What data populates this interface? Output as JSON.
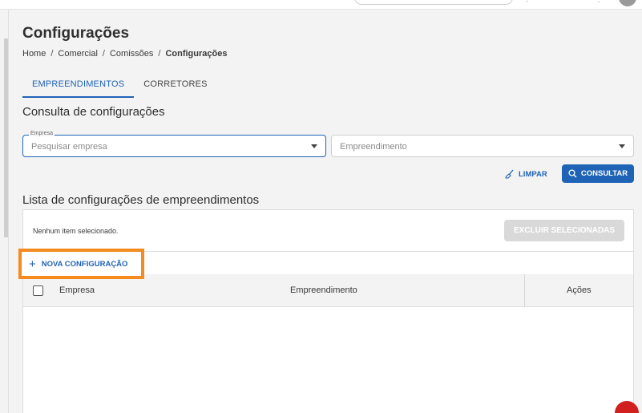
{
  "header": {
    "title": "Configurações"
  },
  "breadcrumb": {
    "items": [
      "Home",
      "Comercial",
      "Comissões",
      "Configurações"
    ],
    "separator": "/"
  },
  "tabs": [
    {
      "label": "EMPREENDIMENTOS",
      "active": true
    },
    {
      "label": "CORRETORES",
      "active": false
    }
  ],
  "query": {
    "title": "Consulta de configurações",
    "company": {
      "label": "Empresa",
      "placeholder": "Pesquisar empresa"
    },
    "development": {
      "placeholder": "Empreendimento"
    },
    "clear_label": "LIMPAR",
    "consult_label": "CONSULTAR"
  },
  "list": {
    "title": "Lista de configurações de empreendimentos",
    "selection_text": "Nenhum item selecionado.",
    "delete_label": "EXCLUIR SELECIONADAS",
    "new_label": "NOVA CONFIGURAÇÃO",
    "columns": [
      "Empresa",
      "Empreendimento",
      "Ações"
    ],
    "rows": []
  },
  "colors": {
    "accent": "#1e63b6",
    "highlight": "#f58a1f",
    "disabled": "#d9d9d9"
  },
  "icons": [
    "search-icon",
    "broom-icon",
    "plus-icon",
    "dropdown-caret-icon"
  ]
}
